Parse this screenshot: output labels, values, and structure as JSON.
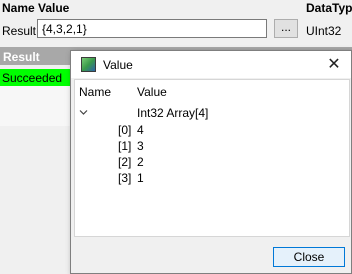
{
  "background": {
    "headers": {
      "name": "Name",
      "value": "Value",
      "type": "DataTyp"
    },
    "row": {
      "label": "Result",
      "value": "{4,3,2,1}",
      "ellipsis": "...",
      "type": "UInt32"
    },
    "result_section": {
      "title": "Result",
      "status": "Succeeded"
    }
  },
  "dialog": {
    "title": "Value",
    "close_glyph": "✕",
    "columns": {
      "name": "Name",
      "value": "Value"
    },
    "root": {
      "value": "Int32 Array[4]"
    },
    "items": [
      {
        "index": "[0]",
        "value": "4"
      },
      {
        "index": "[1]",
        "value": "3"
      },
      {
        "index": "[2]",
        "value": "2"
      },
      {
        "index": "[3]",
        "value": "1"
      }
    ],
    "close_button_label": "Close"
  },
  "colors": {
    "success": "#00ff00",
    "section_header": "#a8a8a8",
    "focus_border": "#0078d7"
  }
}
